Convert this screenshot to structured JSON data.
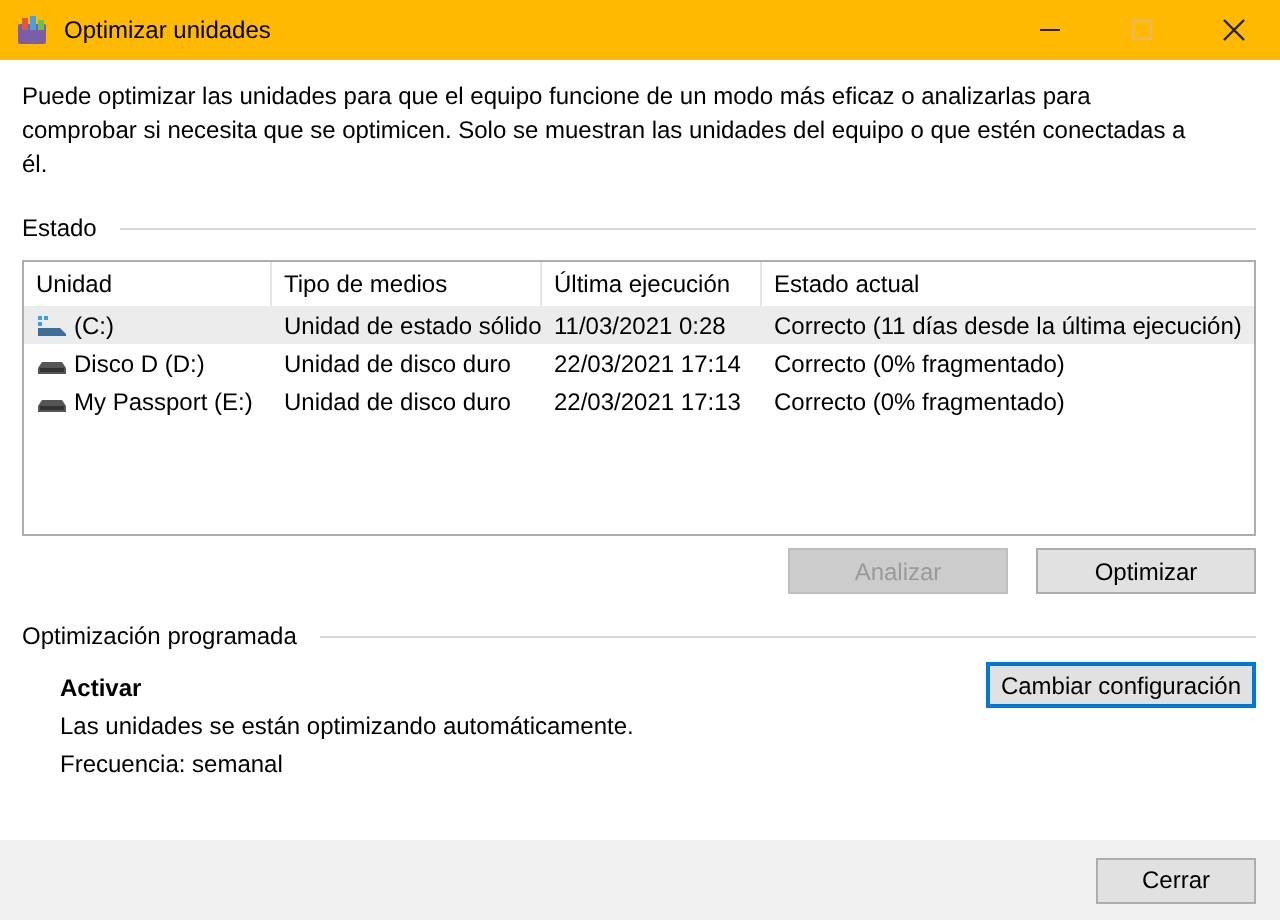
{
  "window": {
    "title": "Optimizar unidades",
    "maximize_disabled": true
  },
  "description": "Puede optimizar las unidades para que el equipo funcione de un modo más eficaz o analizarlas para comprobar si necesita que se optimicen. Solo se muestran las unidades del equipo o que estén conectadas a él.",
  "status_section": {
    "title": "Estado"
  },
  "table": {
    "columns": [
      "Unidad",
      "Tipo de medios",
      "Última ejecución",
      "Estado actual"
    ],
    "rows": [
      {
        "kind": "ssd",
        "selected": true,
        "cells": [
          "(C:)",
          "Unidad de estado sólido",
          "11/03/2021 0:28",
          "Correcto (11 días desde la última ejecución)"
        ]
      },
      {
        "kind": "hdd",
        "selected": false,
        "cells": [
          "Disco D (D:)",
          "Unidad de disco duro",
          "22/03/2021 17:14",
          "Correcto (0% fragmentado)"
        ]
      },
      {
        "kind": "hdd",
        "selected": false,
        "cells": [
          "My Passport (E:)",
          "Unidad de disco duro",
          "22/03/2021 17:13",
          "Correcto (0% fragmentado)"
        ]
      }
    ]
  },
  "actions": [
    {
      "label": "Analizar",
      "disabled": true
    },
    {
      "label": "Optimizar",
      "disabled": false
    }
  ],
  "schedule": {
    "title": "Optimización programada",
    "state": "Activar",
    "info": "Las unidades se están optimizando automáticamente.",
    "frequency": "Frecuencia: semanal",
    "button": {
      "label": "Cambiar configuración",
      "focused": true
    }
  },
  "footer": {
    "button": "Cerrar"
  }
}
